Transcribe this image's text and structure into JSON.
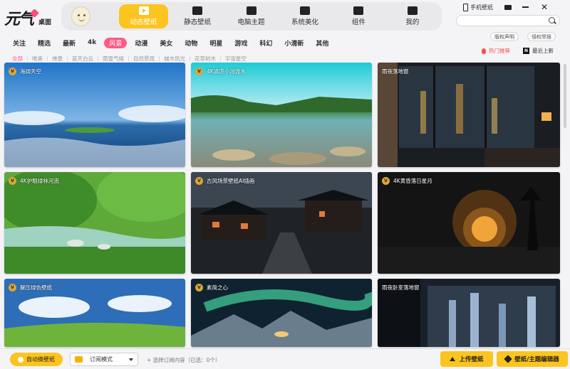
{
  "app": {
    "logo_text": "元气",
    "logo_sub": "桌面"
  },
  "nav": {
    "items": [
      {
        "label": "动态壁纸",
        "icon": "play-icon",
        "active": true
      },
      {
        "label": "静态壁纸",
        "icon": "image-icon",
        "active": false
      },
      {
        "label": "电脑主题",
        "icon": "monitor-icon",
        "active": false
      },
      {
        "label": "系统美化",
        "icon": "flower-icon",
        "active": false
      },
      {
        "label": "组件",
        "icon": "widget-icon",
        "active": false
      },
      {
        "label": "我的",
        "icon": "profile-icon",
        "active": false
      }
    ]
  },
  "window": {
    "phone_label": "手机壁纸",
    "mail_icon": "mail-icon",
    "minimize_icon": "minimize-icon",
    "close_symbol": "✕"
  },
  "search": {
    "placeholder": ""
  },
  "links": {
    "copyright": "版权声明",
    "report": "侵权举报",
    "hot": "热门推荐",
    "latest": "最近上新"
  },
  "categories": [
    "关注",
    "精选",
    "最新",
    "4k",
    "风景",
    "动漫",
    "美女",
    "动物",
    "明星",
    "游戏",
    "科幻",
    "小清新",
    "其他"
  ],
  "active_category": "风景",
  "subcategories": [
    "全部",
    "唯美",
    "禅意",
    "蓝天白云",
    "雨雪气候",
    "自然景观",
    "城市风光",
    "花草树木",
    "宇宙星空"
  ],
  "active_subcategory": "全部",
  "cards": [
    {
      "title": "海阔天空",
      "badge": "V",
      "scene": "sea"
    },
    {
      "title": "4K清凉小河流水",
      "badge": "V",
      "scene": "river"
    },
    {
      "title": "雨夜落地窗",
      "badge": "",
      "scene": "window"
    },
    {
      "title": "4K护眼绿林河流",
      "badge": "V",
      "scene": "forest"
    },
    {
      "title": "古风场景壁纸AI插画",
      "badge": "V",
      "scene": "ancient"
    },
    {
      "title": "4K黄昏落日星月",
      "badge": "V",
      "scene": "dusk"
    },
    {
      "title": "解压绿色壁纸",
      "badge": "V",
      "scene": "meadow"
    },
    {
      "title": "素简之心",
      "badge": "V",
      "scene": "aurora"
    },
    {
      "title": "雨夜卧室落地窗",
      "badge": "",
      "scene": "bedroom"
    }
  ],
  "footer": {
    "auto_label": "自动换壁纸",
    "subscribe_mode": "订阅模式",
    "subscribe_note": "+ 选择订阅内容（已选：0个）",
    "upload_label": "上传壁纸",
    "editor_label": "壁纸/主题编辑器"
  },
  "colors": {
    "accent": "#fcc41e",
    "pink": "#ff5a84",
    "hot": "#ff4c4c"
  }
}
